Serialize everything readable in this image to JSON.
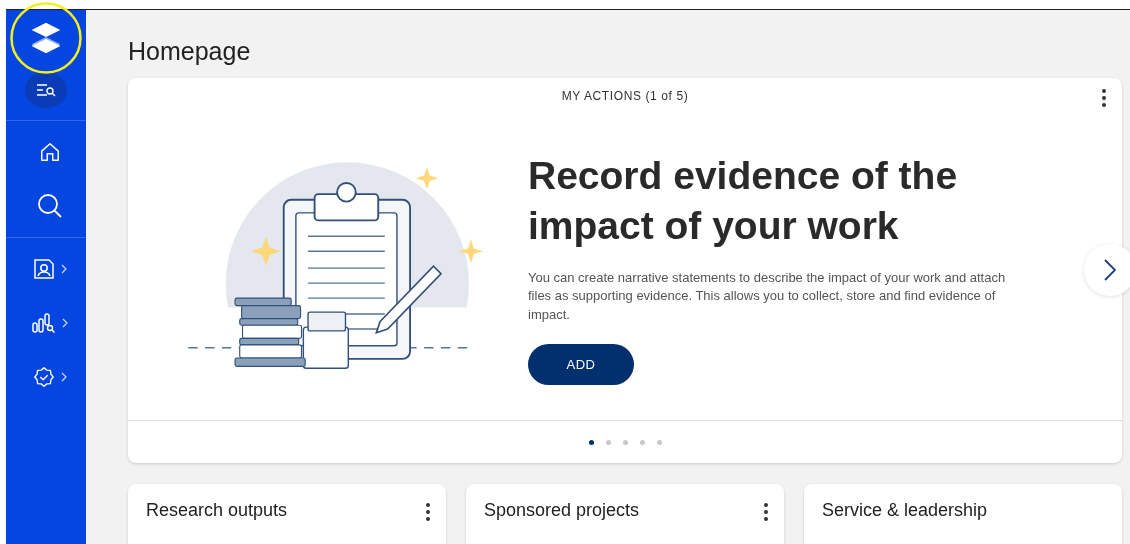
{
  "sidebar": {
    "items": [
      {
        "kind": "filter"
      },
      {
        "kind": "divider"
      },
      {
        "kind": "home",
        "expandable": false
      },
      {
        "kind": "search",
        "expandable": false
      },
      {
        "kind": "divider"
      },
      {
        "kind": "profile",
        "expandable": true
      },
      {
        "kind": "analytics",
        "expandable": true
      },
      {
        "kind": "verified",
        "expandable": true
      }
    ]
  },
  "page": {
    "title": "Homepage"
  },
  "actions_card": {
    "header": "MY ACTIONS (1 of 5)",
    "heading": "Record evidence of the impact of your work",
    "description": "You can create narrative statements to describe the impact of your work and attach files as supporting evidence. This allows you to collect, store and find evidence of impact.",
    "button": "ADD",
    "dots": [
      {
        "selected": true
      },
      {
        "selected": false
      },
      {
        "selected": false
      },
      {
        "selected": false
      },
      {
        "selected": false
      }
    ]
  },
  "cards": [
    {
      "title": "Research outputs",
      "menu": true
    },
    {
      "title": "Sponsored projects",
      "menu": true
    },
    {
      "title": "Service & leadership",
      "menu": false
    }
  ]
}
